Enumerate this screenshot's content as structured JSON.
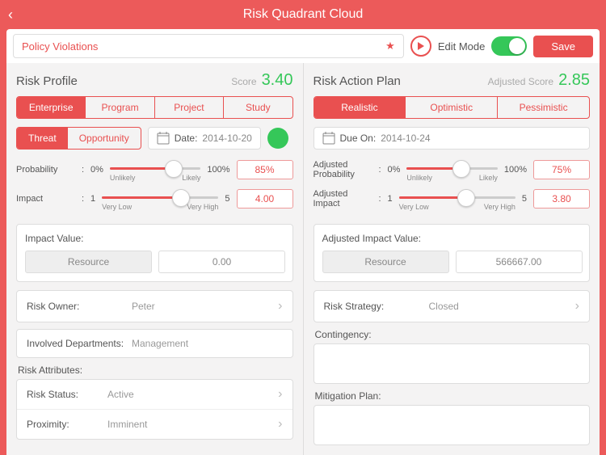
{
  "title": "Risk Quadrant Cloud",
  "header": {
    "seed": "Policy Violations",
    "edit_label": "Edit Mode",
    "save_label": "Save"
  },
  "left": {
    "title": "Risk Profile",
    "score_label": "Score",
    "score": "3.40",
    "tabs": [
      "Enterprise",
      "Program",
      "Project",
      "Study"
    ],
    "tabs2": [
      "Threat",
      "Opportunity"
    ],
    "date_label": "Date:",
    "date": "2014-10-20",
    "prob": {
      "label": "Probability",
      "min": "0%",
      "max": "100%",
      "low": "Unlikely",
      "high": "Likely",
      "value": "85%",
      "pct": 70
    },
    "impact": {
      "label": "Impact",
      "min": "1",
      "max": "5",
      "low": "Very Low",
      "high": "Very High",
      "value": "4.00",
      "pct": 68
    },
    "impact_value": {
      "title": "Impact Value:",
      "resource": "Resource",
      "amount": "0.00"
    },
    "owner": {
      "k": "Risk Owner:",
      "v": "Peter"
    },
    "dept": {
      "k": "Involved Departments:",
      "v": "Management"
    },
    "attrs_title": "Risk Attributes:",
    "attrs": [
      {
        "k": "Risk Status:",
        "v": "Active"
      },
      {
        "k": "Proximity:",
        "v": "Imminent"
      }
    ]
  },
  "right": {
    "title": "Risk Action Plan",
    "score_label": "Adjusted Score",
    "score": "2.85",
    "tabs": [
      "Realistic",
      "Optimistic",
      "Pessimistic"
    ],
    "due_label": "Due On:",
    "due": "2014-10-24",
    "prob": {
      "label": "Adjusted Probability",
      "min": "0%",
      "max": "100%",
      "low": "Unlikely",
      "high": "Likely",
      "value": "75%",
      "pct": 60
    },
    "impact": {
      "label": "Adjusted Impact",
      "min": "1",
      "max": "5",
      "low": "Very Low",
      "high": "Very High",
      "value": "3.80",
      "pct": 58
    },
    "impact_value": {
      "title": "Adjusted Impact Value:",
      "resource": "Resource",
      "amount": "566667.00"
    },
    "strategy": {
      "k": "Risk Strategy:",
      "v": "Closed"
    },
    "contingency_label": "Contingency:",
    "mitigation_label": "Mitigation Plan:"
  }
}
